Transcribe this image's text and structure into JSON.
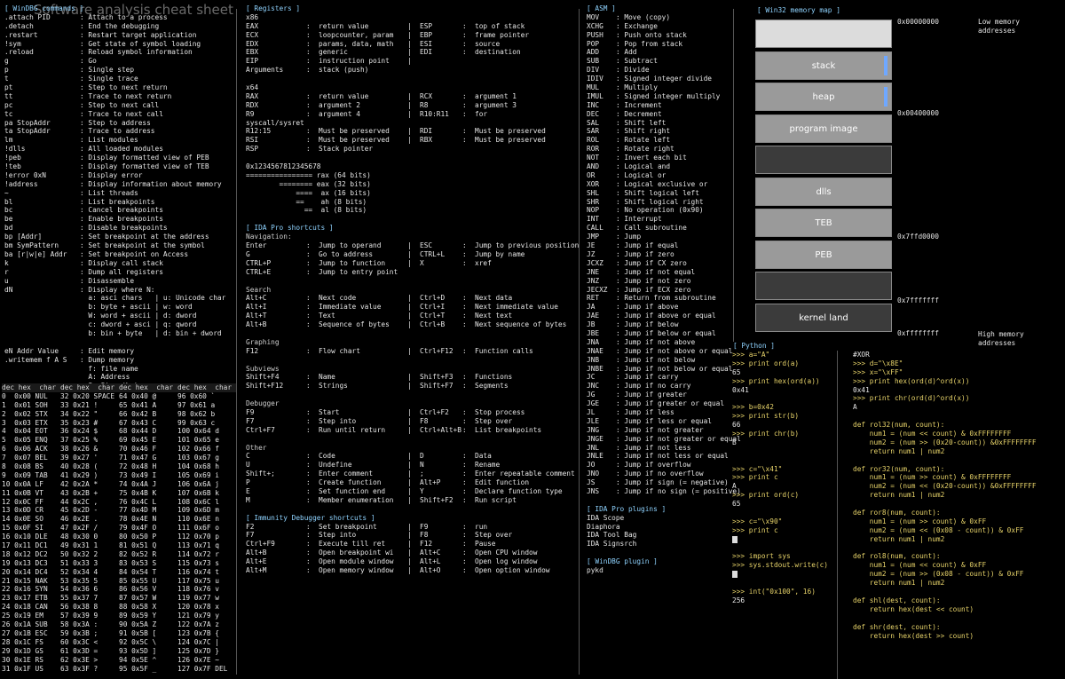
{
  "watermark": "Software analysis cheat sheet",
  "windbg": {
    "title": "[ WinDBG commands ]",
    "rows": [
      [
        ".attach PID",
        ": Attach to a process"
      ],
      [
        ".detach",
        ": End the debugging"
      ],
      [
        ".restart",
        ": Restart target application"
      ],
      [
        "!sym",
        ": Get state of symbol loading"
      ],
      [
        ".reload",
        ": Reload symbol information"
      ],
      [
        "g",
        ": Go"
      ],
      [
        "p",
        ": Single step"
      ],
      [
        "t",
        ": Single trace"
      ],
      [
        "pt",
        ": Step to next return"
      ],
      [
        "tt",
        ": Trace to next return"
      ],
      [
        "pc",
        ": Step to next call"
      ],
      [
        "tc",
        ": Trace to next call"
      ],
      [
        "pa StopAddr",
        ": Step to address"
      ],
      [
        "ta StopAddr",
        ": Trace to address"
      ],
      [
        "lm",
        ": List modules"
      ],
      [
        "!dlls",
        ": All loaded modules"
      ],
      [
        "!peb",
        ": Display formatted view of PEB"
      ],
      [
        "!teb",
        ": Display formatted view of TEB"
      ],
      [
        "!error 0xN",
        ": Display error"
      ],
      [
        "!address",
        ": Display information about memory"
      ],
      [
        "~",
        ": List threads"
      ],
      [
        "bl",
        ": List breakpoints"
      ],
      [
        "bc",
        ": Cancel breakpoints"
      ],
      [
        "be",
        ": Enable breakpoints"
      ],
      [
        "bd",
        ": Disable breakpoints"
      ],
      [
        "bp [Addr]",
        ": Set breakpoint at the address"
      ],
      [
        "bm SymPattern",
        ": Set breakpoint at the symbol"
      ],
      [
        "ba [r|w|e] Addr",
        ": Set breakpoint on Access"
      ],
      [
        "k",
        ": Display call stack"
      ],
      [
        "r",
        ": Dump all registers"
      ],
      [
        "u",
        ": Disassemble"
      ],
      [
        "dN",
        ": Display where N:"
      ],
      [
        "",
        "  a: asci chars   | u: Unicode char"
      ],
      [
        "",
        "  b: byte + ascii | w: word"
      ],
      [
        "",
        "  W: word + ascii | d: dword"
      ],
      [
        "",
        "  c: dword + asci | q: qword"
      ],
      [
        "",
        "  b: bin + byte   | d: bin + dword"
      ],
      [
        "",
        ""
      ],
      [
        "eN Addr Value",
        ": Edit memory"
      ],
      [
        ".writemem f A S",
        ": Dump memory"
      ],
      [
        "",
        "  f: file name"
      ],
      [
        "",
        "  A: Address"
      ],
      [
        "",
        "  S: Size (Lx)"
      ]
    ]
  },
  "ascii": {
    "header": [
      "dec hex  char",
      "dec hex  char",
      "dec hex  char",
      "dec hex  char"
    ],
    "rows": [
      [
        "0  0x00 NUL",
        "32 0x20 SPACE",
        "64 0x40 @",
        "96 0x60 `"
      ],
      [
        "1  0x01 SOH",
        "33 0x21 !",
        "65 0x41 A",
        "97 0x61 a"
      ],
      [
        "2  0x02 STX",
        "34 0x22 \"",
        "66 0x42 B",
        "98 0x62 b"
      ],
      [
        "3  0x03 ETX",
        "35 0x23 #",
        "67 0x43 C",
        "99 0x63 c"
      ],
      [
        "4  0x04 EOT",
        "36 0x24 $",
        "68 0x44 D",
        "100 0x64 d"
      ],
      [
        "5  0x05 ENQ",
        "37 0x25 %",
        "69 0x45 E",
        "101 0x65 e"
      ],
      [
        "6  0x06 ACK",
        "38 0x26 &",
        "70 0x46 F",
        "102 0x66 f"
      ],
      [
        "7  0x07 BEL",
        "39 0x27 '",
        "71 0x47 G",
        "103 0x67 g"
      ],
      [
        "8  0x08 BS",
        "40 0x28 (",
        "72 0x48 H",
        "104 0x68 h"
      ],
      [
        "9  0x09 TAB",
        "41 0x29 )",
        "73 0x49 I",
        "105 0x69 i"
      ],
      [
        "10 0x0A LF",
        "42 0x2A *",
        "74 0x4A J",
        "106 0x6A j"
      ],
      [
        "11 0x0B VT",
        "43 0x2B +",
        "75 0x4B K",
        "107 0x6B k"
      ],
      [
        "12 0x0C FF",
        "44 0x2C ,",
        "76 0x4C L",
        "108 0x6C l"
      ],
      [
        "13 0x0D CR",
        "45 0x2D -",
        "77 0x4D M",
        "109 0x6D m"
      ],
      [
        "14 0x0E SO",
        "46 0x2E .",
        "78 0x4E N",
        "110 0x6E n"
      ],
      [
        "15 0x0F SI",
        "47 0x2F /",
        "79 0x4F O",
        "111 0x6F o"
      ],
      [
        "16 0x10 DLE",
        "48 0x30 0",
        "80 0x50 P",
        "112 0x70 p"
      ],
      [
        "17 0x11 DC1",
        "49 0x31 1",
        "81 0x51 Q",
        "113 0x71 q"
      ],
      [
        "18 0x12 DC2",
        "50 0x32 2",
        "82 0x52 R",
        "114 0x72 r"
      ],
      [
        "19 0x13 DC3",
        "51 0x33 3",
        "83 0x53 S",
        "115 0x73 s"
      ],
      [
        "20 0x14 DC4",
        "52 0x34 4",
        "84 0x54 T",
        "116 0x74 t"
      ],
      [
        "21 0x15 NAK",
        "53 0x35 5",
        "85 0x55 U",
        "117 0x75 u"
      ],
      [
        "22 0x16 SYN",
        "54 0x36 6",
        "86 0x56 V",
        "118 0x76 v"
      ],
      [
        "23 0x17 ETB",
        "55 0x37 7",
        "87 0x57 W",
        "119 0x77 w"
      ],
      [
        "24 0x18 CAN",
        "56 0x38 8",
        "88 0x58 X",
        "120 0x78 x"
      ],
      [
        "25 0x19 EM",
        "57 0x39 9",
        "89 0x59 Y",
        "121 0x79 y"
      ],
      [
        "26 0x1A SUB",
        "58 0x3A :",
        "90 0x5A Z",
        "122 0x7A z"
      ],
      [
        "27 0x1B ESC",
        "59 0x3B ;",
        "91 0x5B [",
        "123 0x7B {"
      ],
      [
        "28 0x1C FS",
        "60 0x3C <",
        "92 0x5C \\",
        "124 0x7C |"
      ],
      [
        "29 0x1D GS",
        "61 0x3D =",
        "93 0x5D ]",
        "125 0x7D }"
      ],
      [
        "30 0x1E RS",
        "62 0x3E >",
        "94 0x5E ^",
        "126 0x7E ~"
      ],
      [
        "31 0x1F US",
        "63 0x3F ?",
        "95 0x5F _",
        "127 0x7F DEL"
      ]
    ]
  },
  "registers": {
    "title": "[ Registers ]",
    "x86_label": "x86",
    "x86": [
      [
        "EAX",
        ":",
        "return value",
        "|",
        "ESP",
        ":",
        "top of stack"
      ],
      [
        "ECX",
        ":",
        "loopcounter, param",
        "|",
        "EBP",
        ":",
        "frame pointer"
      ],
      [
        "EDX",
        ":",
        "params, data, math",
        "|",
        "ESI",
        ":",
        "source"
      ],
      [
        "EBX",
        ":",
        "generic",
        "|",
        "EDI",
        ":",
        "destination"
      ],
      [
        "EIP",
        ":",
        "instruction point",
        "|",
        "",
        "",
        ""
      ],
      [
        "Arguments",
        ":",
        "stack (push)",
        "",
        "",
        "",
        ""
      ]
    ],
    "x64_label": "x64",
    "x64": [
      [
        "RAX",
        ":",
        "return value",
        "|",
        "RCX",
        ":",
        "argument 1"
      ],
      [
        "RDX",
        ":",
        "argument 2",
        "|",
        "R8",
        ":",
        "argument 3"
      ],
      [
        "R9",
        ":",
        "argument 4",
        "|",
        "R10:R11",
        ":",
        "for"
      ]
    ],
    "syscall_label": "syscall/sysret",
    "syscall": [
      [
        "R12:15",
        ":",
        "Must be preserved",
        "|",
        "RDI",
        ":",
        "Must be preserved"
      ],
      [
        "RSI",
        ":",
        "Must be preserved",
        "|",
        "RBX",
        ":",
        "Must be preserved"
      ],
      [
        "RSP",
        ":",
        "Stack pointer",
        "",
        "",
        "",
        ""
      ]
    ],
    "bits": [
      "0x1234567812345678",
      "================ rax (64 bits)",
      "        ======== eax (32 bits)",
      "            ====  ax (16 bits)",
      "            ==    ah (8 bits)",
      "              ==  al (8 bits)"
    ]
  },
  "ida": {
    "title": "[ IDA Pro shortcuts ]",
    "sections": [
      {
        "name": "Navigation:",
        "rows": [
          [
            "Enter",
            ":",
            "Jump to operand",
            "|",
            "ESC",
            ":",
            "Jump to previous position"
          ],
          [
            "G",
            ":",
            "Go to address",
            "|",
            "CTRL+L",
            ":",
            "Jump by name"
          ],
          [
            "CTRL+P",
            ":",
            "Jump to function",
            "|",
            "X",
            ":",
            "xref"
          ],
          [
            "CTRL+E",
            ":",
            "Jump to entry point",
            "",
            "",
            "",
            ""
          ]
        ]
      },
      {
        "name": "Search",
        "rows": [
          [
            "Alt+C",
            ":",
            "Next code",
            "|",
            "Ctrl+D",
            ":",
            "Next data"
          ],
          [
            "Alt+I",
            ":",
            "Immediate value",
            "|",
            "Ctrl+I",
            ":",
            "Next immediate value"
          ],
          [
            "Alt+T",
            ":",
            "Text",
            "|",
            "Ctrl+T",
            ":",
            "Next text"
          ],
          [
            "Alt+B",
            ":",
            "Sequence of bytes",
            "|",
            "Ctrl+B",
            ":",
            "Next sequence of bytes"
          ]
        ]
      },
      {
        "name": "Graphing",
        "rows": [
          [
            "F12",
            ":",
            "Flow chart",
            "|",
            "Ctrl+F12",
            ":",
            "Function calls"
          ]
        ]
      },
      {
        "name": "Subviews",
        "rows": [
          [
            "Shift+F4",
            ":",
            "Name",
            "|",
            "Shift+F3",
            ":",
            "Functions"
          ],
          [
            "Shift+F12",
            ":",
            "Strings",
            "|",
            "Shift+F7",
            ":",
            "Segments"
          ]
        ]
      },
      {
        "name": "Debugger",
        "rows": [
          [
            "F9",
            ":",
            "Start",
            "|",
            "Ctrl+F2",
            ":",
            "Stop process"
          ],
          [
            "F7",
            ":",
            "Step into",
            "|",
            "F8",
            ":",
            "Step over"
          ],
          [
            "Ctrl+F7",
            ":",
            "Run until return",
            "|",
            "Ctrl+Alt+B",
            ":",
            "List breakpoints"
          ]
        ]
      },
      {
        "name": "Other",
        "rows": [
          [
            "C",
            ":",
            "Code",
            "|",
            "D",
            ":",
            "Data"
          ],
          [
            "U",
            ":",
            "Undefine",
            "|",
            "N",
            ":",
            "Rename"
          ],
          [
            "Shift+;",
            ":",
            "Enter comment",
            "|",
            ";",
            ":",
            "Enter repeatable comment"
          ],
          [
            "P",
            ":",
            "Create function",
            "|",
            "Alt+P",
            ":",
            "Edit function"
          ],
          [
            "E",
            ":",
            "Set function end",
            "|",
            "Y",
            ":",
            "Declare function type"
          ],
          [
            "M",
            ":",
            "Member enumeration",
            "|",
            "Shift+F2",
            ":",
            "Run script"
          ]
        ]
      }
    ]
  },
  "immunity": {
    "title": "[ Immunity Debugger shortcuts ]",
    "rows": [
      [
        "F2",
        ":",
        "Set breakpoint",
        "|",
        "F9",
        ":",
        "run"
      ],
      [
        "F7",
        ":",
        "Step into",
        "|",
        "F8",
        ":",
        "Step over"
      ],
      [
        "Ctrl+F9",
        ":",
        "Execute till ret",
        "|",
        "F12",
        ":",
        "Pause"
      ],
      [
        "Alt+B",
        ":",
        "Open breakpoint wi",
        "|",
        "Alt+C",
        ":",
        "Open CPU window"
      ],
      [
        "Alt+E",
        ":",
        "Open module window",
        "|",
        "Alt+L",
        ":",
        "Open log window"
      ],
      [
        "Alt+M",
        ":",
        "Open memory window",
        "|",
        "Alt+O",
        ":",
        "Open option window"
      ]
    ]
  },
  "asm": {
    "title": "[ ASM ]",
    "rows": [
      [
        "MOV",
        ": Move (copy)"
      ],
      [
        "XCHG",
        ": Exchange"
      ],
      [
        "PUSH",
        ": Push onto stack"
      ],
      [
        "POP",
        ": Pop from stack"
      ],
      [
        "ADD",
        ": Add"
      ],
      [
        "SUB",
        ": Subtract"
      ],
      [
        "DIV",
        ": Divide"
      ],
      [
        "IDIV",
        ": Signed integer divide"
      ],
      [
        "MUL",
        ": Multiply"
      ],
      [
        "IMUL",
        ": Signed integer multiply"
      ],
      [
        "INC",
        ": Increment"
      ],
      [
        "DEC",
        ": Decrement"
      ],
      [
        "SAL",
        ": Shift left"
      ],
      [
        "SAR",
        ": Shift right"
      ],
      [
        "ROL",
        ": Rotate left"
      ],
      [
        "ROR",
        ": Rotate right"
      ],
      [
        "NOT",
        ": Invert each bit"
      ],
      [
        "AND",
        ": Logical and"
      ],
      [
        "OR",
        ": Logical or"
      ],
      [
        "XOR",
        ": Logical exclusive or"
      ],
      [
        "SHL",
        ": Shift logical left"
      ],
      [
        "SHR",
        ": Shift logical right"
      ],
      [
        "NOP",
        ": No operation (0x90)"
      ],
      [
        "INT",
        ": Interrupt"
      ],
      [
        "CALL",
        ": Call subroutine"
      ],
      [
        "JMP",
        ": Jump"
      ],
      [
        "JE",
        ": Jump if equal"
      ],
      [
        "JZ",
        ": Jump if zero"
      ],
      [
        "JCXZ",
        ": Jump if CX zero"
      ],
      [
        "JNE",
        ": Jump if not equal"
      ],
      [
        "JNZ",
        ": Jump if not zero"
      ],
      [
        "JECXZ",
        ": Jump if ECX zero"
      ],
      [
        "RET",
        ": Return from subroutine"
      ],
      [
        "JA",
        ": Jump if above"
      ],
      [
        "JAE",
        ": Jump if above or equal"
      ],
      [
        "JB",
        ": Jump if below"
      ],
      [
        "JBE",
        ": Jump if below or equal"
      ],
      [
        "JNA",
        ": Jump if not above"
      ],
      [
        "JNAE",
        ": Jump if not above or equal"
      ],
      [
        "JNB",
        ": Jump if not below"
      ],
      [
        "JNBE",
        ": Jump if not below or equal"
      ],
      [
        "JC",
        ": Jump if carry"
      ],
      [
        "JNC",
        ": Jump if no carry"
      ],
      [
        "JG",
        ": Jump if greater"
      ],
      [
        "JGE",
        ": Jump if greater or equal"
      ],
      [
        "JL",
        ": Jump if less"
      ],
      [
        "JLE",
        ": Jump if less or equal"
      ],
      [
        "JNG",
        ": Jump if not greater"
      ],
      [
        "JNGE",
        ": Jump if not greater or equal"
      ],
      [
        "JNL",
        ": Jump if not less"
      ],
      [
        "JNLE",
        ": Jump if not less or equal"
      ],
      [
        "JO",
        ": Jump if overflow"
      ],
      [
        "JNO",
        ": Jump if no overflow"
      ],
      [
        "JS",
        ": Jump if sign (= negative)"
      ],
      [
        "JNS",
        ": Jump if no sign (= positive)"
      ]
    ]
  },
  "ida_plugins": {
    "title": "[ IDA Pro plugins ]",
    "items": [
      "IDA Scope",
      "Diaphora",
      "IDA Tool Bag",
      "IDA Signsrch"
    ]
  },
  "windbg_plugin": {
    "title": "[ WinDBG plugin ]",
    "items": [
      "pykd"
    ]
  },
  "memmap": {
    "title": "[ Win32 memory map ]",
    "blocks": [
      "",
      "stack",
      "heap",
      "program image",
      "",
      "dlls",
      "TEB",
      "PEB",
      "",
      "kernel land"
    ],
    "addresses": [
      "0x00000000",
      "0x00400000",
      "0x7ffd0000",
      "0x7fffffff",
      "0xffffffff"
    ],
    "low": "Low memory\naddresses",
    "high": "High memory\naddresses"
  },
  "python": {
    "title": "[ Python ]",
    "left": [
      ">>> a=\"A\"",
      ">>> print ord(a)",
      "65",
      ">>> print hex(ord(a))",
      "0x41",
      "",
      ">>> b=0x42",
      ">>> print str(b)",
      "66",
      ">>> print chr(b)",
      "B",
      "",
      "",
      ">>> c=\"\\x41\"",
      ">>> print c",
      "A",
      ">>> print ord(c)",
      "65",
      "",
      ">>> c=\"\\x90\"",
      ">>> print c",
      "[]",
      "",
      ">>> import sys",
      ">>> sys.stdout.write(c)",
      "[]",
      "",
      ">>> int(\"0x100\", 16)",
      "256"
    ],
    "right": [
      "#XOR",
      ">>> d=\"\\x8E\"",
      ">>> x=\"\\xFF\"",
      ">>> print hex(ord(d)^ord(x))",
      "0x41",
      ">>> print chr(ord(d)^ord(x))",
      "A",
      "",
      "def rol32(num, count):",
      "    num1 = (num << count) & 0xFFFFFFFF",
      "    num2 = (num >> (0x20-count)) &0xFFFFFFFF",
      "    return num1 | num2",
      "",
      "def ror32(num, count):",
      "    num1 = (num >> count) & 0xFFFFFFFF",
      "    num2 = (num << (0x20-count)) &0xFFFFFFFF",
      "    return num1 | num2",
      "",
      "def ror8(num, count):",
      "    num1 = (num >> count) & 0xFF",
      "    num2 = (num << (0x08 - count)) & 0xFF",
      "    return num1 | num2",
      "",
      "def rol8(num, count):",
      "    num1 = (num << count) & 0xFF",
      "    num2 = (num >> (0x08 - count)) & 0xFF",
      "    return num1 | num2",
      "",
      "def shl(dest, count):",
      "    return hex(dest << count)",
      "",
      "def shr(dest, count):",
      "    return hex(dest >> count)"
    ]
  }
}
